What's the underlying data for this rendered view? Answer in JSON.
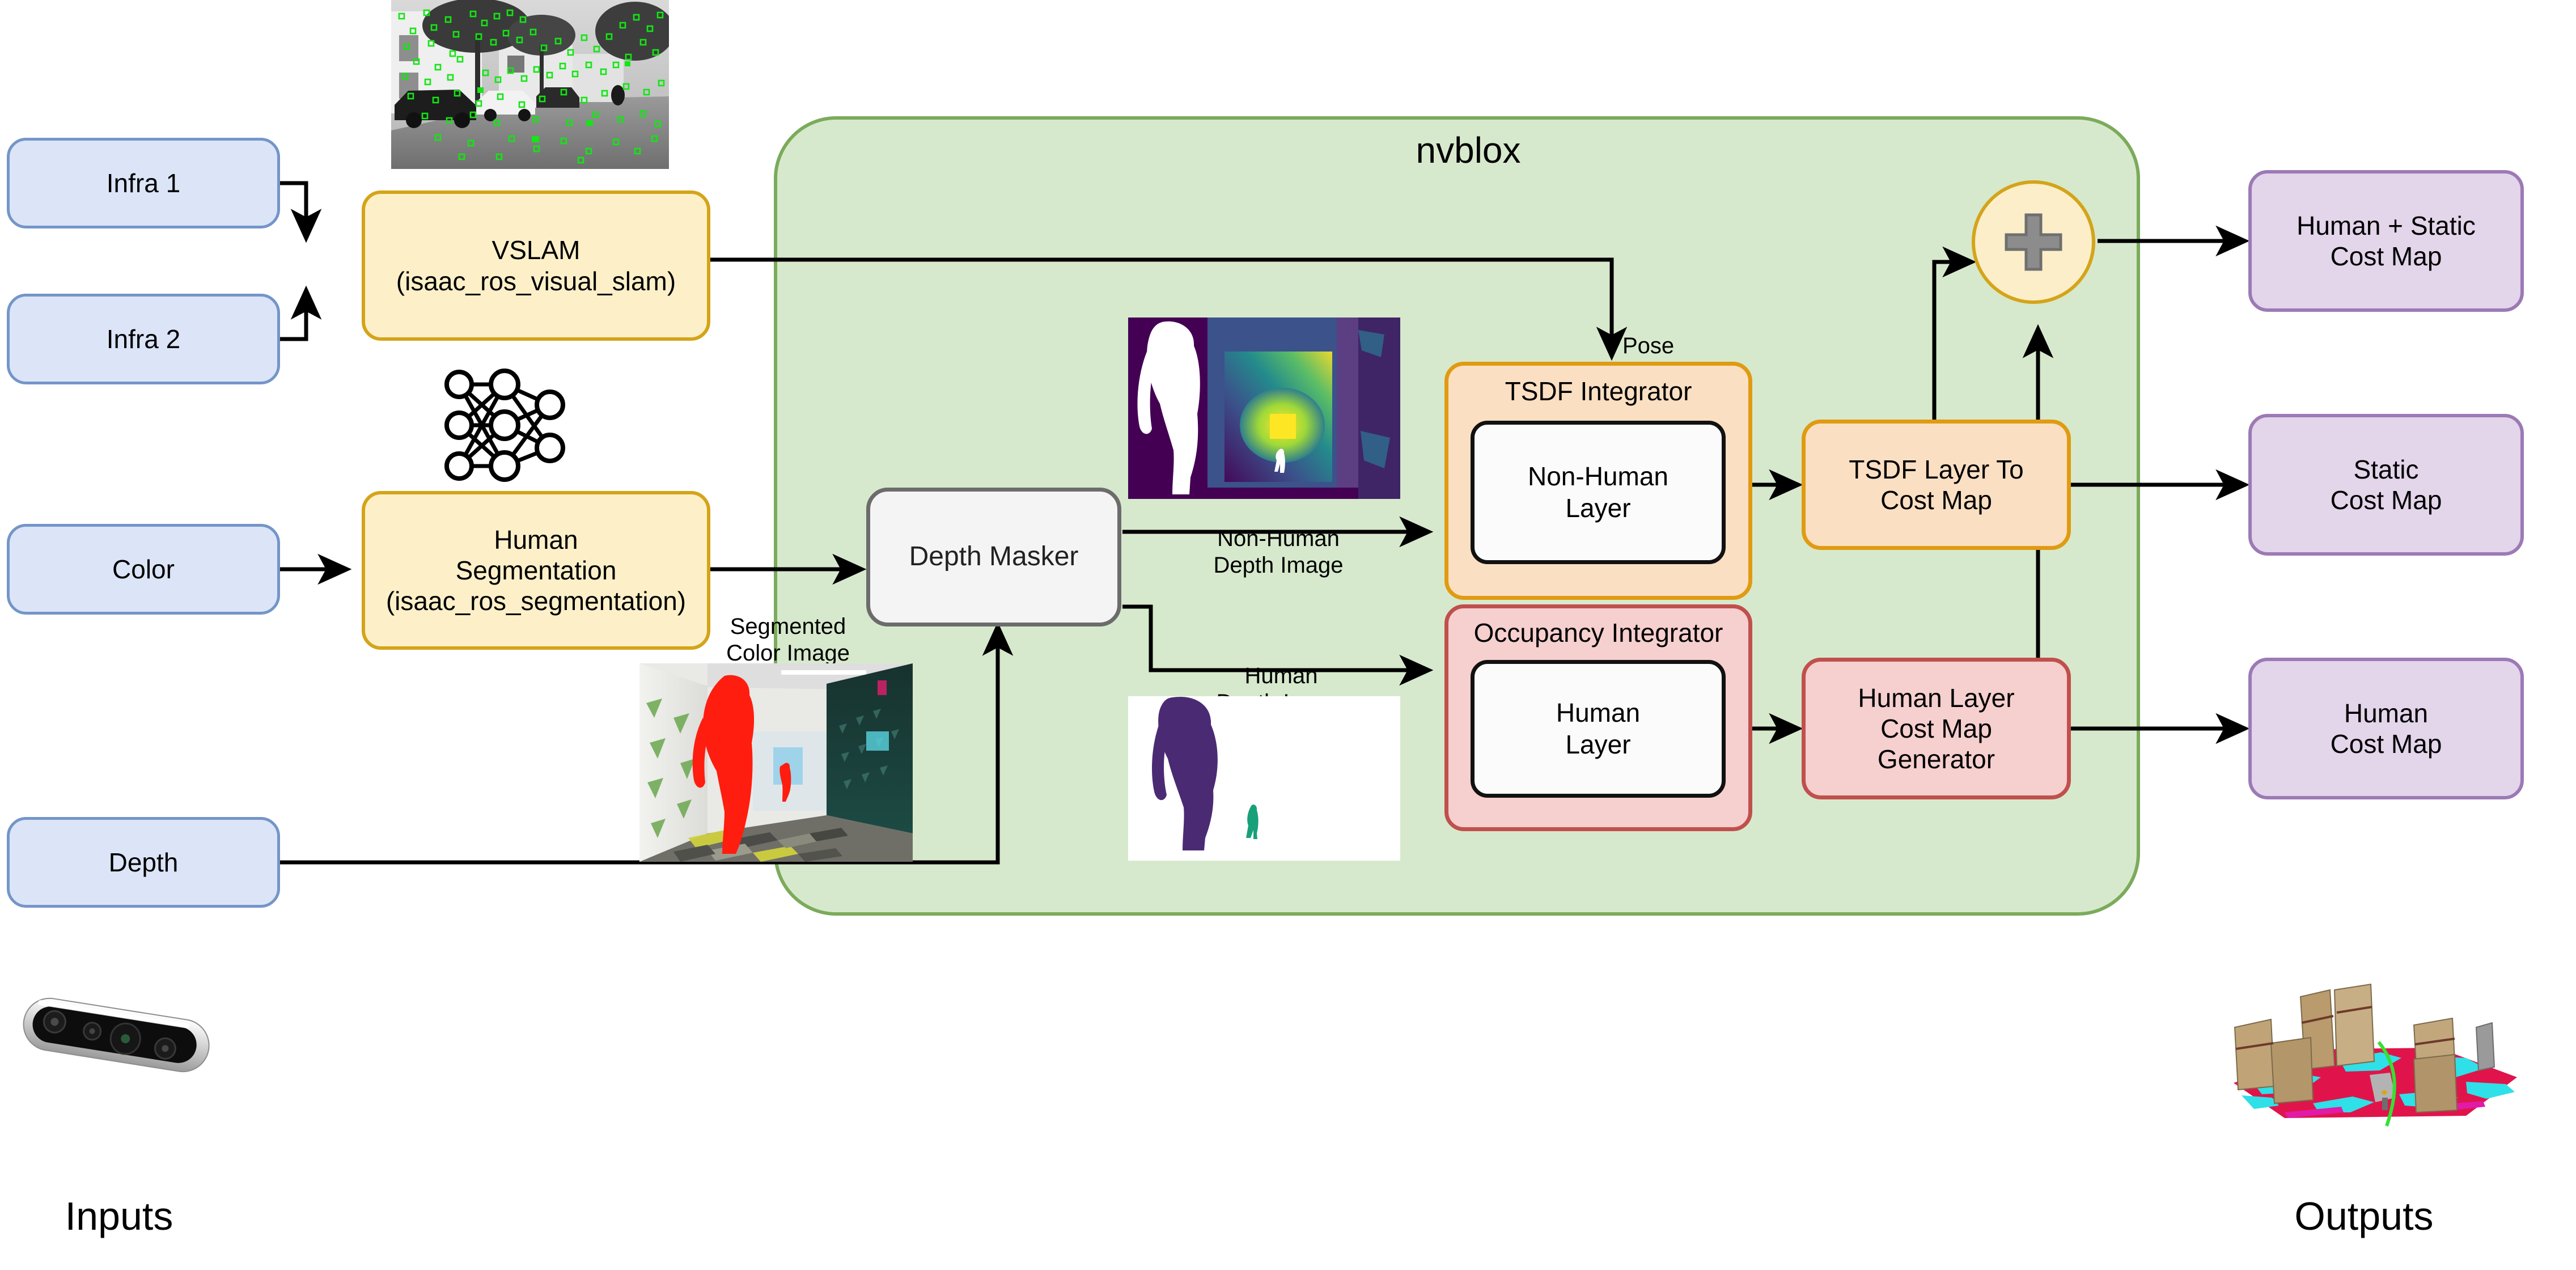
{
  "diagram": {
    "container_title": "nvblox",
    "captions": {
      "inputs": "Inputs",
      "outputs": "Outputs"
    }
  },
  "inputs": [
    {
      "id": "infra1",
      "label": "Infra 1"
    },
    {
      "id": "infra2",
      "label": "Infra 2"
    },
    {
      "id": "color",
      "label": "Color"
    },
    {
      "id": "depth",
      "label": "Depth"
    }
  ],
  "processing": [
    {
      "id": "vslam",
      "label": "VSLAM\n(isaac_ros_visual_slam)"
    },
    {
      "id": "human_segmentation",
      "label": "Human\nSegmentation\n(isaac_ros_segmentation)"
    },
    {
      "id": "depth_masker",
      "label": "Depth Masker"
    }
  ],
  "nvblox_blocks": [
    {
      "id": "tsdf_integrator",
      "title": "TSDF Integrator",
      "inner": "Non-Human\nLayer"
    },
    {
      "id": "occupancy_integrator",
      "title": "Occupancy Integrator",
      "inner": "Human\nLayer"
    },
    {
      "id": "tsdf_layer_to_cost_map",
      "label": "TSDF Layer To\nCost Map"
    },
    {
      "id": "human_layer_cost_map_generator",
      "label": "Human Layer\nCost Map\nGenerator"
    },
    {
      "id": "sum_node",
      "label": "+"
    }
  ],
  "outputs": [
    {
      "id": "human_static_cost_map",
      "label": "Human + Static\nCost Map"
    },
    {
      "id": "static_cost_map",
      "label": "Static\nCost Map"
    },
    {
      "id": "human_cost_map",
      "label": "Human\nCost Map"
    }
  ],
  "edge_labels": [
    {
      "id": "pose",
      "text": "Pose"
    },
    {
      "id": "segmented_color_image",
      "text": "Segmented\nColor Image"
    },
    {
      "id": "non_human_depth_image",
      "text": "Non-Human\nDepth Image"
    },
    {
      "id": "human_depth_image",
      "text": "Human\nDepth Image"
    }
  ],
  "images": [
    {
      "id": "vslam_feature_image",
      "alt": "grayscale street scene with green feature tracks"
    },
    {
      "id": "segmented_color_image_thumb",
      "alt": "indoor corridor with person highlighted in red"
    },
    {
      "id": "depth_image_thumb",
      "alt": "viridis colormap depth image with white person silhouette"
    },
    {
      "id": "human_depth_image_thumb",
      "alt": "white background with purple human silhouette"
    },
    {
      "id": "reconstruction_map_thumb",
      "alt": "3D reconstructed mesh with red and cyan cost map"
    },
    {
      "id": "realsense_camera",
      "alt": "stereo depth camera"
    },
    {
      "id": "neural_network_icon",
      "alt": "fully connected neural network graph"
    }
  ],
  "colors": {
    "input_fill": "#dbe5f7",
    "input_stroke": "#7495c8",
    "yellow_fill": "#fdf0c9",
    "yellow_stroke": "#d4a419",
    "orange_fill": "#fbdfc3",
    "orange_stroke": "#e09b12",
    "red_fill": "#f6cfcf",
    "red_stroke": "#c0504d",
    "purple_fill": "#e3d5ea",
    "purple_stroke": "#9c7ab5",
    "green_fill": "#d7e9cd",
    "green_stroke": "#7bab5b",
    "grey_fill": "#f4f4f4",
    "grey_stroke": "#6c6c6c",
    "plus_glyph": "#8c8c8c",
    "arrow": "#000000"
  }
}
